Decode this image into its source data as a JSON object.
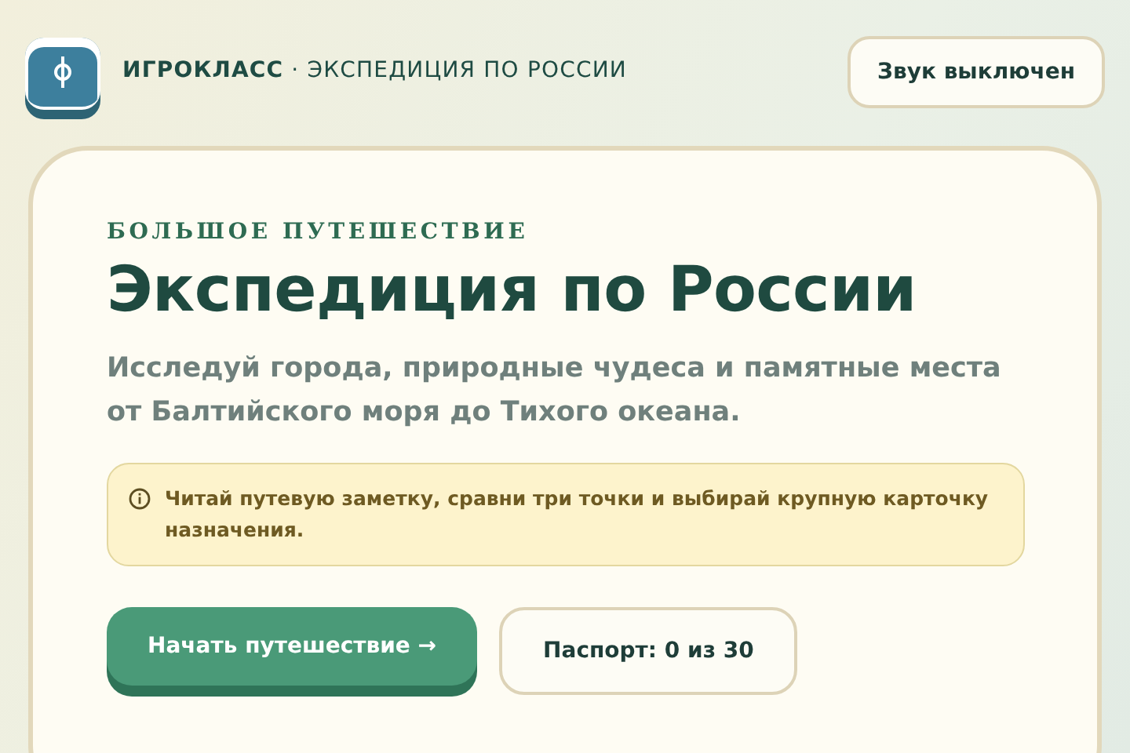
{
  "header": {
    "brand": "ИГРОКЛАСС",
    "subtitle": "· ЭКСПЕДИЦИЯ ПО РОССИИ",
    "sound_button": "Звук выключен"
  },
  "hero": {
    "eyebrow": "БОЛЬШОЕ ПУТЕШЕСТВИЕ",
    "title": "Экспедиция по России",
    "description": "Исследуй города, природные чудеса и памятные места от Балтийского моря до Тихого океана.",
    "hint": "Читай путевую заметку, сравни три точки и выбирай крупную карточку назначения.",
    "buttons": [
      {
        "kind": "primary",
        "label": "Начать путешествие →"
      },
      {
        "kind": "secondary",
        "label": "Паспорт: 0 из 30"
      }
    ]
  }
}
